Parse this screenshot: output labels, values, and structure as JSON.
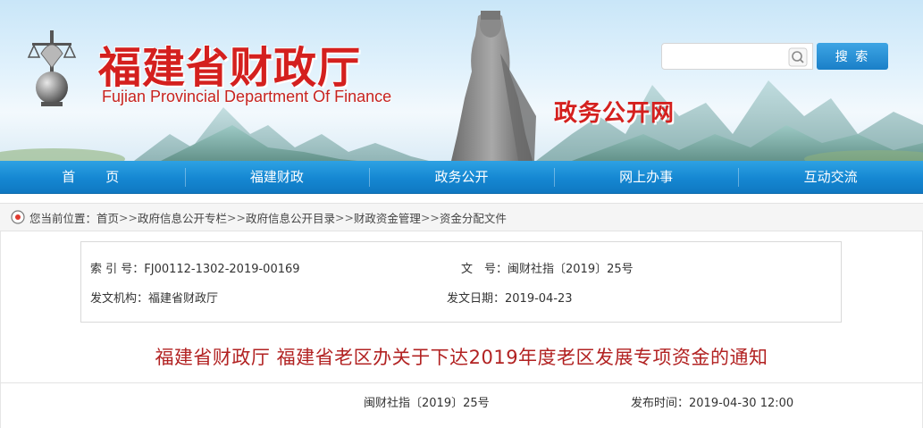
{
  "header": {
    "title_cn": "福建省财政厅",
    "title_en": "Fujian Provincial Department Of Finance",
    "subsite": "政务公开网",
    "search": {
      "placeholder": "",
      "button_label": "搜 索"
    }
  },
  "nav": {
    "items": [
      {
        "label": "首页"
      },
      {
        "label": "福建财政"
      },
      {
        "label": "政务公开"
      },
      {
        "label": "网上办事"
      },
      {
        "label": "互动交流"
      }
    ]
  },
  "breadcrumb": {
    "prefix": "您当前位置：",
    "items": [
      "首页",
      "政府信息公开专栏",
      "政府信息公开目录",
      "财政资金管理",
      "资金分配文件"
    ],
    "separator": ">>"
  },
  "meta": {
    "index_label": "索 引 号：",
    "index_value": "FJ00112-1302-2019-00169",
    "docno_label": "文　号：",
    "docno_value": "闽财社指〔2019〕25号",
    "issuer_label": "发文机构：",
    "issuer_value": "福建省财政厅",
    "issue_date_label": "发文日期：",
    "issue_date_value": "2019-04-23"
  },
  "document": {
    "title": "福建省财政厅 福建省老区办关于下达2019年度老区发展专项资金的通知",
    "docno": "闽财社指〔2019〕25号",
    "publish_label": "发布时间：",
    "publish_value": "2019-04-30 12:00"
  },
  "colors": {
    "brand_red": "#d4201e",
    "nav_blue": "#1587d2",
    "title_red": "#b22222"
  }
}
